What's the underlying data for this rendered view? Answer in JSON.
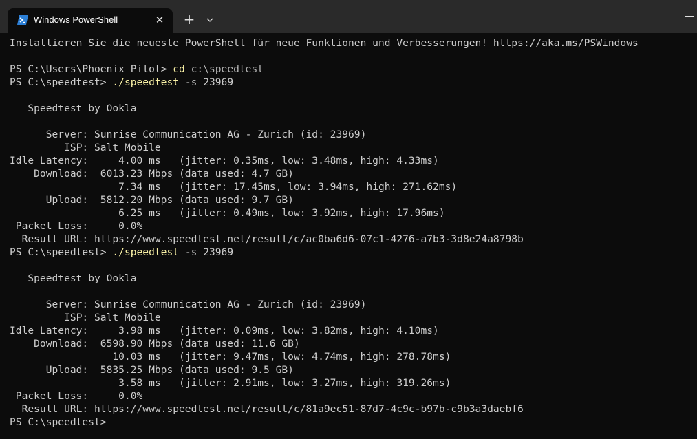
{
  "window": {
    "tab_title": "Windows PowerShell",
    "tab_close": "✕",
    "new_tab": "+",
    "dropdown_icon": "chevron-down-icon",
    "app_icon": "powershell-icon"
  },
  "terminal": {
    "lines": [
      {
        "type": "text",
        "text": "Installieren Sie die neueste PowerShell für neue Funktionen und Verbesserungen! https://aka.ms/PSWindows"
      },
      {
        "type": "text",
        "text": ""
      },
      {
        "type": "prompt",
        "prompt": "PS C:\\Users\\Phoenix Pilot> ",
        "cmd": "cd",
        "args": " c:\\speedtest",
        "num": ""
      },
      {
        "type": "prompt",
        "prompt": "PS C:\\speedtest> ",
        "cmd": "./speedtest",
        "args": " -s ",
        "num": "23969"
      },
      {
        "type": "text",
        "text": ""
      },
      {
        "type": "text",
        "text": "   Speedtest by Ookla"
      },
      {
        "type": "text",
        "text": ""
      },
      {
        "type": "text",
        "text": "      Server: Sunrise Communication AG - Zurich (id: 23969)"
      },
      {
        "type": "text",
        "text": "         ISP: Salt Mobile"
      },
      {
        "type": "text",
        "text": "Idle Latency:     4.00 ms   (jitter: 0.35ms, low: 3.48ms, high: 4.33ms)"
      },
      {
        "type": "text",
        "text": "    Download:  6013.23 Mbps (data used: 4.7 GB)"
      },
      {
        "type": "text",
        "text": "                  7.34 ms   (jitter: 17.45ms, low: 3.94ms, high: 271.62ms)"
      },
      {
        "type": "text",
        "text": "      Upload:  5812.20 Mbps (data used: 9.7 GB)"
      },
      {
        "type": "text",
        "text": "                  6.25 ms   (jitter: 0.49ms, low: 3.92ms, high: 17.96ms)"
      },
      {
        "type": "text",
        "text": " Packet Loss:     0.0%"
      },
      {
        "type": "text",
        "text": "  Result URL: https://www.speedtest.net/result/c/ac0ba6d6-07c1-4276-a7b3-3d8e24a8798b"
      },
      {
        "type": "prompt",
        "prompt": "PS C:\\speedtest> ",
        "cmd": "./speedtest",
        "args": " -s ",
        "num": "23969"
      },
      {
        "type": "text",
        "text": ""
      },
      {
        "type": "text",
        "text": "   Speedtest by Ookla"
      },
      {
        "type": "text",
        "text": ""
      },
      {
        "type": "text",
        "text": "      Server: Sunrise Communication AG - Zurich (id: 23969)"
      },
      {
        "type": "text",
        "text": "         ISP: Salt Mobile"
      },
      {
        "type": "text",
        "text": "Idle Latency:     3.98 ms   (jitter: 0.09ms, low: 3.82ms, high: 4.10ms)"
      },
      {
        "type": "text",
        "text": "    Download:  6598.90 Mbps (data used: 11.6 GB)"
      },
      {
        "type": "text",
        "text": "                 10.03 ms   (jitter: 9.47ms, low: 4.74ms, high: 278.78ms)"
      },
      {
        "type": "text",
        "text": "      Upload:  5835.25 Mbps (data used: 9.5 GB)"
      },
      {
        "type": "text",
        "text": "                  3.58 ms   (jitter: 2.91ms, low: 3.27ms, high: 319.26ms)"
      },
      {
        "type": "text",
        "text": " Packet Loss:     0.0%"
      },
      {
        "type": "text",
        "text": "  Result URL: https://www.speedtest.net/result/c/81a9ec51-87d7-4c9c-b97b-c9b3a3daebf6"
      },
      {
        "type": "text",
        "text": "PS C:\\speedtest>"
      }
    ]
  },
  "colors": {
    "background": "#0c0c0c",
    "titlebar": "#2a2a2a",
    "text": "#cccccc",
    "command": "#f9f1a5",
    "argument": "#b4b4b4",
    "ps_icon": "#2c7fd6"
  }
}
